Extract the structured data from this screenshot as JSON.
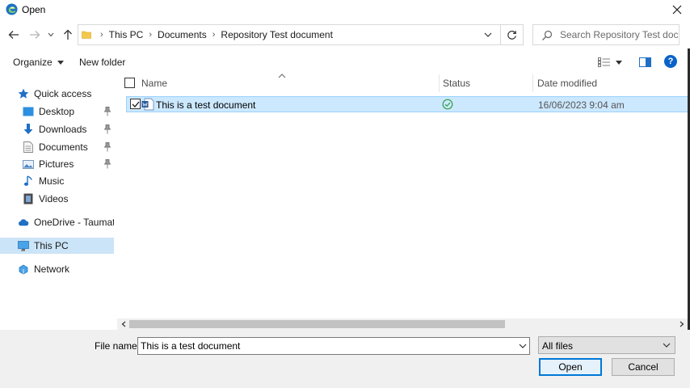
{
  "window": {
    "title": "Open",
    "close_label": "✕"
  },
  "address": {
    "crumbs": [
      "This PC",
      "Documents",
      "Repository Test document"
    ],
    "separator": "›"
  },
  "search": {
    "placeholder": "Search Repository Test docu..."
  },
  "toolbar": {
    "organize_label": "Organize",
    "new_folder_label": "New folder"
  },
  "sidebar": {
    "items": [
      {
        "label": "Quick access"
      },
      {
        "label": "Desktop"
      },
      {
        "label": "Downloads"
      },
      {
        "label": "Documents"
      },
      {
        "label": "Pictures"
      },
      {
        "label": "Music"
      },
      {
        "label": "Videos"
      },
      {
        "label": "OneDrive - Taumata A"
      },
      {
        "label": "This PC"
      },
      {
        "label": "Network"
      }
    ]
  },
  "filelist": {
    "columns": {
      "name": "Name",
      "status": "Status",
      "date_modified": "Date modified"
    },
    "rows": [
      {
        "name": "This is a test document",
        "date_modified": "16/06/2023 9:04 am"
      }
    ]
  },
  "bottom": {
    "file_name_label": "File name:",
    "file_name_value": "This is a test document",
    "filter_value": "All files",
    "open_label": "Open",
    "cancel_label": "Cancel"
  },
  "colors": {
    "selection_bg": "#cce8ff",
    "nav_selected_bg": "#cce4f7",
    "accent": "#0078d7",
    "status_ok": "#2e9e44"
  }
}
